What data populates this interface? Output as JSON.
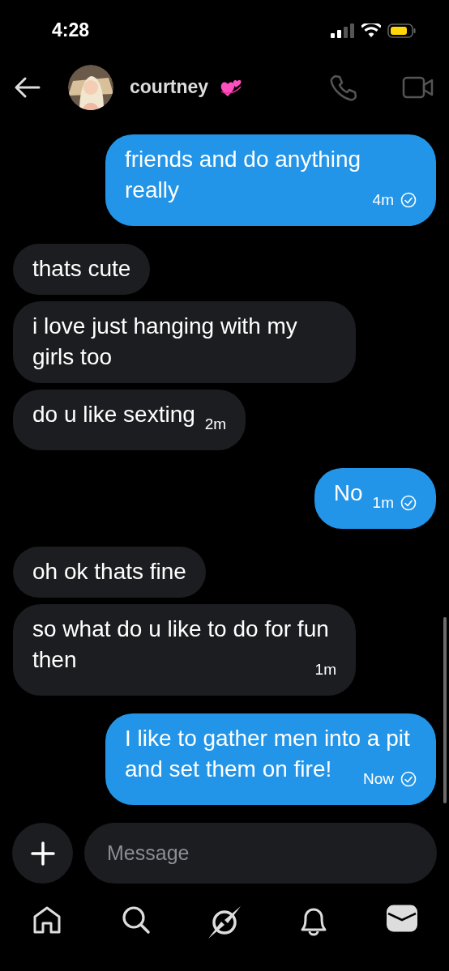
{
  "status_bar": {
    "time": "4:28"
  },
  "header": {
    "title": "courtney"
  },
  "messages": [
    {
      "kind": "out",
      "text": "friends and do anything really",
      "time": "4m",
      "seen": true
    },
    {
      "kind": "in",
      "text": "thats cute"
    },
    {
      "kind": "in",
      "text": "i love just hanging with my girls too"
    },
    {
      "kind": "in",
      "text": "do u like sexting",
      "time": "2m"
    },
    {
      "kind": "out",
      "text": "No",
      "time": "1m",
      "seen": true
    },
    {
      "kind": "in",
      "text": "oh ok thats fine"
    },
    {
      "kind": "in",
      "text": "so what do u like to do for fun then",
      "time": "1m"
    },
    {
      "kind": "out",
      "text": "I like to gather men into a pit and set them on fire!",
      "time": "Now",
      "seen": true
    }
  ],
  "composer": {
    "placeholder": "Message"
  },
  "nav": [
    {
      "kind": "home",
      "selected": false
    },
    {
      "kind": "search",
      "selected": false
    },
    {
      "kind": "explore",
      "selected": false
    },
    {
      "kind": "bell",
      "selected": false
    },
    {
      "kind": "mail",
      "selected": true
    }
  ]
}
